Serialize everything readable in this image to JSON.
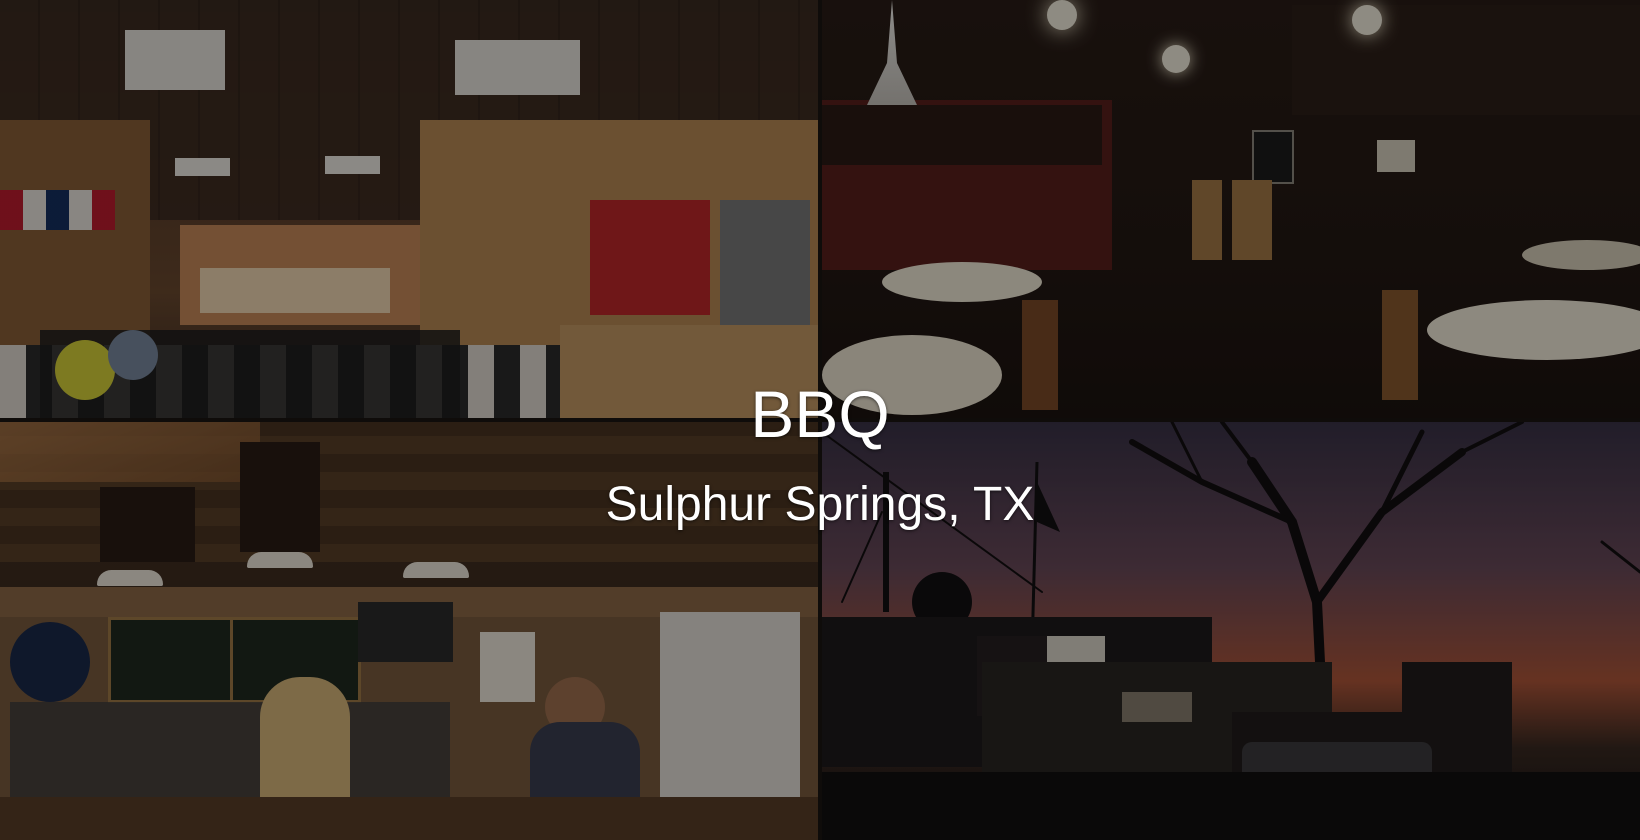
{
  "headline": "BBQ",
  "location": "Sulphur Springs, TX",
  "photos": [
    {
      "icon": "restaurant-interior-photo"
    },
    {
      "icon": "dining-room-photo"
    },
    {
      "icon": "counter-menu-board-photo"
    },
    {
      "icon": "sunset-exterior-photo"
    }
  ]
}
